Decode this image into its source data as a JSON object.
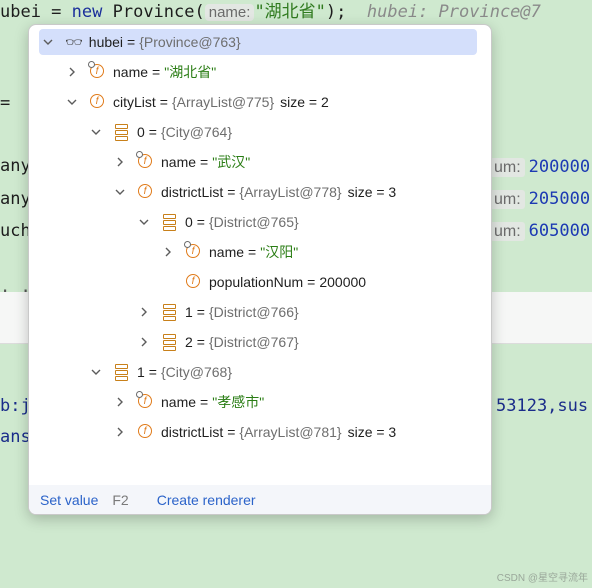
{
  "editor": {
    "line1": {
      "pre": "ubei = ",
      "kw": "new",
      "cls": " Province(",
      "hint": "name:",
      "str": "\"湖北省\"",
      "post": ");",
      "inlay": "hubei: Province@7"
    },
    "frag_eq": "=",
    "frag_any1": "any",
    "frag_any2": "any",
    "frag_uch": "uch",
    "frag_dots": ". .",
    "frag_b": "b:j",
    "frag_ans": "ans",
    "right_hints": [
      {
        "label": "um:",
        "value": "200000"
      },
      {
        "label": "um:",
        "value": "205000"
      },
      {
        "label": "um:",
        "value": "605000"
      }
    ],
    "right_text": "53123,sus",
    "watermark": "CSDN @星空寻流年"
  },
  "popup": {
    "rows": [
      {
        "name": "hubei",
        "type": "{Province@763}"
      },
      {
        "name": "name",
        "str": "\"湖北省\""
      },
      {
        "name": "cityList",
        "type": "{ArrayList@775}",
        "size": "size = 2"
      },
      {
        "name": "0",
        "type": "{City@764}"
      },
      {
        "name": "name",
        "str": "\"武汉\""
      },
      {
        "name": "districtList",
        "type": "{ArrayList@778}",
        "size": "size = 3"
      },
      {
        "name": "0",
        "type": "{District@765}"
      },
      {
        "name": "name",
        "str": "\"汉阳\""
      },
      {
        "name": "populationNum",
        "num": "200000"
      },
      {
        "name": "1",
        "type": "{District@766}"
      },
      {
        "name": "2",
        "type": "{District@767}"
      },
      {
        "name": "1",
        "type": "{City@768}"
      },
      {
        "name": "name",
        "str": "\"孝感市\""
      },
      {
        "name": "districtList",
        "type": "{ArrayList@781}",
        "size": "size = 3"
      }
    ],
    "equals": "=",
    "footer": {
      "set_value": "Set value",
      "key": "F2",
      "create_renderer": "Create renderer"
    }
  }
}
